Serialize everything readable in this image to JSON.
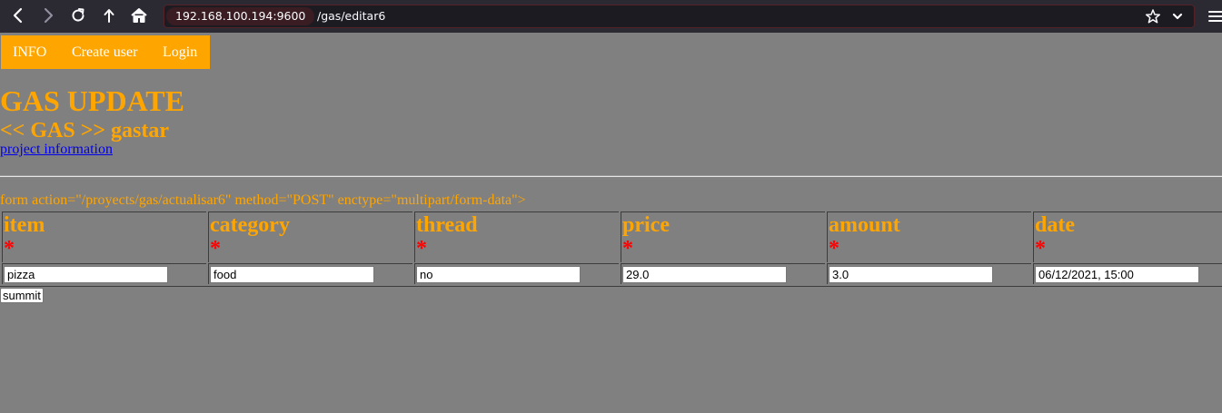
{
  "browser": {
    "url_host": "192.168.100.194:9600",
    "url_path": "/gas/editar6",
    "icons": {
      "back": "back-arrow-icon",
      "forward": "forward-arrow-icon",
      "reload": "reload-icon",
      "upload": "upload-icon",
      "home": "home-icon",
      "bookmark": "star-icon",
      "dropdown": "chevron-down-icon",
      "menu": "hamburger-menu-icon"
    }
  },
  "nav": {
    "items": [
      {
        "label": "INFO"
      },
      {
        "label": "Create user"
      },
      {
        "label": "Login"
      }
    ],
    "background": "#ffa500"
  },
  "header": {
    "title": "GAS UPDATE",
    "subtitle": "<< GAS >> gastar",
    "link": "project information"
  },
  "form": {
    "raw_text": "form action=\"/proyects/gas/actualisar6\" method=\"POST\" enctype=\"multipart/form-data\">",
    "required_mark": "*",
    "columns": [
      {
        "label": "item",
        "value": "pizza"
      },
      {
        "label": "category",
        "value": "food"
      },
      {
        "label": "thread",
        "value": "no"
      },
      {
        "label": "price",
        "value": "29.0"
      },
      {
        "label": "amount",
        "value": "3.0"
      },
      {
        "label": "date",
        "value": "06/12/2021, 15:00"
      }
    ],
    "submit_label": "summit"
  },
  "colors": {
    "accent": "#ffa500",
    "required": "#ff0000",
    "link": "#0000ee",
    "page_background": "#808080"
  }
}
